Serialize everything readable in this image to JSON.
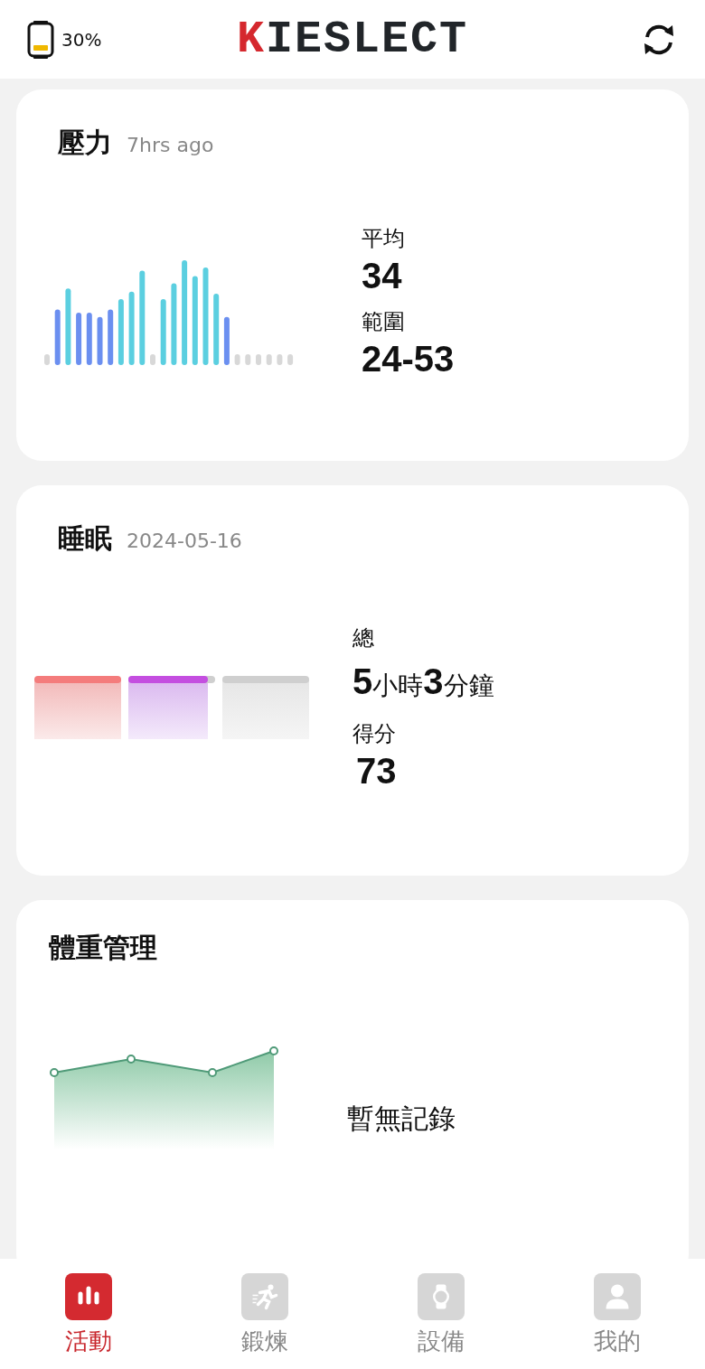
{
  "header": {
    "battery": "30%",
    "logo": "KIESLECT"
  },
  "stress": {
    "title": "壓力",
    "time": "7hrs ago",
    "stats": [
      {
        "label": "平均",
        "value": "34"
      },
      {
        "label": "範圍",
        "value": "24-53"
      }
    ]
  },
  "sleep": {
    "title": "睡眠",
    "date": "2024-05-16",
    "stats": [
      {
        "label": "總",
        "value": "**5**小時**3**分鐘"
      },
      {
        "label": "得分",
        "value": "73"
      }
    ]
  },
  "weight": {
    "title": "體重管理",
    "empty": "暫無記錄"
  },
  "nav": [
    {
      "label": "活動",
      "selected": true
    },
    {
      "label": "鍛煉",
      "selected": false
    },
    {
      "label": "設備",
      "selected": false
    },
    {
      "label": "我的",
      "selected": false
    }
  ]
}
